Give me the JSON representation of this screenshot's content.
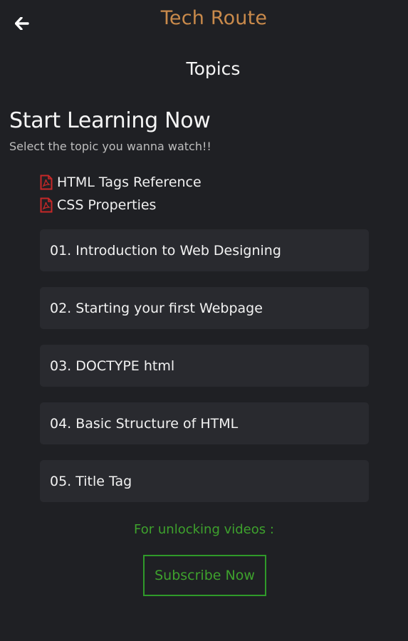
{
  "header": {
    "title": "Tech Route",
    "back_icon": "back-arrow-icon"
  },
  "page": {
    "title": "Topics",
    "heading": "Start Learning Now",
    "subheading": "Select the topic you wanna watch!!"
  },
  "references": [
    {
      "icon": "pdf-icon",
      "label": "HTML Tags Reference"
    },
    {
      "icon": "pdf-icon",
      "label": "CSS Properties"
    }
  ],
  "topics": [
    {
      "label": "01. Introduction to Web Designing"
    },
    {
      "label": "02. Starting your first Webpage"
    },
    {
      "label": "03. DOCTYPE html"
    },
    {
      "label": "04. Basic Structure of HTML"
    },
    {
      "label": "05. Title Tag"
    }
  ],
  "unlock": {
    "text": "For unlocking videos :",
    "button_label": "Subscribe Now"
  },
  "colors": {
    "background": "#1f2024",
    "card": "#292a2f",
    "brand": "#c98a4b",
    "accent_green": "#3ea12d",
    "pdf_red": "#c62828"
  }
}
